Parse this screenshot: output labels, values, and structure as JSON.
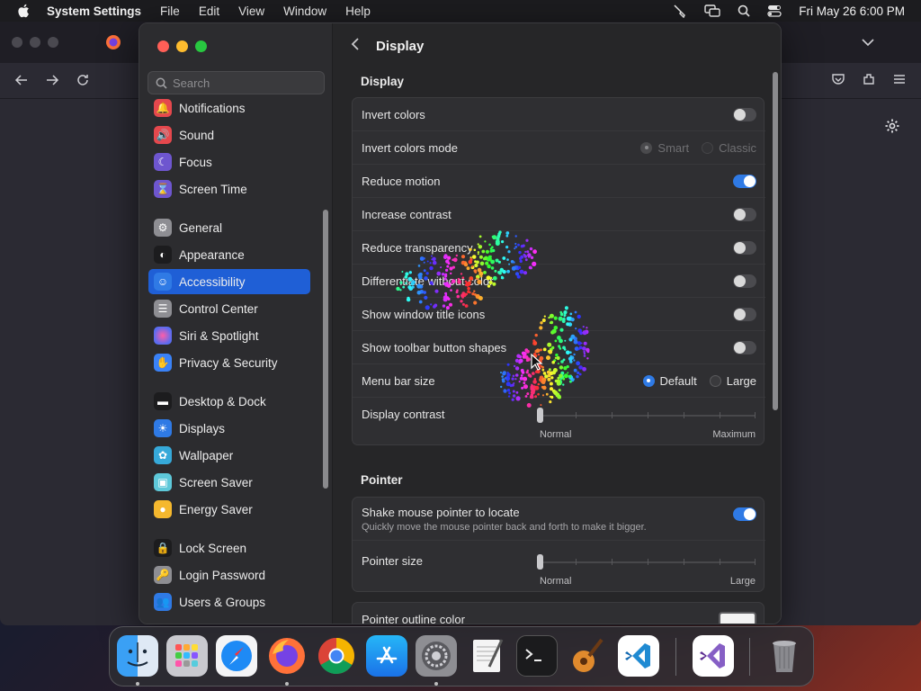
{
  "menubar": {
    "app_name": "System Settings",
    "menus": [
      "File",
      "Edit",
      "View",
      "Window",
      "Help"
    ],
    "clock": "Fri May 26  6:00 PM"
  },
  "sidebar": {
    "search_placeholder": "Search",
    "items": [
      {
        "label": "Notifications",
        "color": "#e5484d",
        "icon": "bell-icon"
      },
      {
        "label": "Sound",
        "color": "#e5484d",
        "icon": "speaker-icon"
      },
      {
        "label": "Focus",
        "color": "#6e56cf",
        "icon": "moon-icon"
      },
      {
        "label": "Screen Time",
        "color": "#6e56cf",
        "icon": "hourglass-icon"
      },
      {
        "label": "General",
        "color": "#8e8e93",
        "icon": "gear-icon"
      },
      {
        "label": "Appearance",
        "color": "#1c1c1e",
        "icon": "appearance-icon"
      },
      {
        "label": "Accessibility",
        "color": "#2f7ae5",
        "icon": "accessibility-icon"
      },
      {
        "label": "Control Center",
        "color": "#8e8e93",
        "icon": "toggles-icon"
      },
      {
        "label": "Siri & Spotlight",
        "color": "#b455d8",
        "icon": "siri-icon"
      },
      {
        "label": "Privacy & Security",
        "color": "#3a82f7",
        "icon": "hand-icon"
      },
      {
        "label": "Desktop & Dock",
        "color": "#1c1c1e",
        "icon": "dock-icon"
      },
      {
        "label": "Displays",
        "color": "#2f7ae5",
        "icon": "sun-icon"
      },
      {
        "label": "Wallpaper",
        "color": "#36a9d9",
        "icon": "flower-icon"
      },
      {
        "label": "Screen Saver",
        "color": "#5ec8d9",
        "icon": "screensaver-icon"
      },
      {
        "label": "Energy Saver",
        "color": "#f5b82e",
        "icon": "bulb-icon"
      },
      {
        "label": "Lock Screen",
        "color": "#1c1c1e",
        "icon": "lock-icon"
      },
      {
        "label": "Login Password",
        "color": "#8e8e93",
        "icon": "key-lock-icon"
      },
      {
        "label": "Users & Groups",
        "color": "#2f7ae5",
        "icon": "users-icon"
      }
    ]
  },
  "content": {
    "title": "Display",
    "display_section": {
      "title": "Display",
      "invert_colors": {
        "label": "Invert colors",
        "on": false
      },
      "invert_colors_mode": {
        "label": "Invert colors mode",
        "options": [
          "Smart",
          "Classic"
        ],
        "selected": "Smart"
      },
      "reduce_motion": {
        "label": "Reduce motion",
        "on": true
      },
      "increase_contrast": {
        "label": "Increase contrast",
        "on": false
      },
      "reduce_transparency": {
        "label": "Reduce transparency",
        "on": false
      },
      "differentiate": {
        "label": "Differentiate without color",
        "on": false
      },
      "window_title_icons": {
        "label": "Show window title icons",
        "on": false
      },
      "toolbar_button_shapes": {
        "label": "Show toolbar button shapes",
        "on": false
      },
      "menu_bar_size": {
        "label": "Menu bar size",
        "options": [
          "Default",
          "Large"
        ],
        "selected": "Default"
      },
      "display_contrast": {
        "label": "Display contrast",
        "min_label": "Normal",
        "max_label": "Maximum",
        "value": 0
      }
    },
    "pointer_section": {
      "title": "Pointer",
      "shake": {
        "label": "Shake mouse pointer to locate",
        "sub": "Quickly move the mouse pointer back and forth to make it bigger.",
        "on": true
      },
      "pointer_size": {
        "label": "Pointer size",
        "min_label": "Normal",
        "max_label": "Large",
        "value": 0
      },
      "outline_color": {
        "label": "Pointer outline color",
        "color": "#ffffff"
      }
    }
  },
  "dock": {
    "apps": [
      "Finder",
      "Launchpad",
      "Safari",
      "Firefox",
      "Chrome",
      "App Store",
      "System Settings",
      "TextEdit",
      "Terminal",
      "GarageBand",
      "VS Code",
      "Visual Studio",
      "Trash"
    ]
  }
}
